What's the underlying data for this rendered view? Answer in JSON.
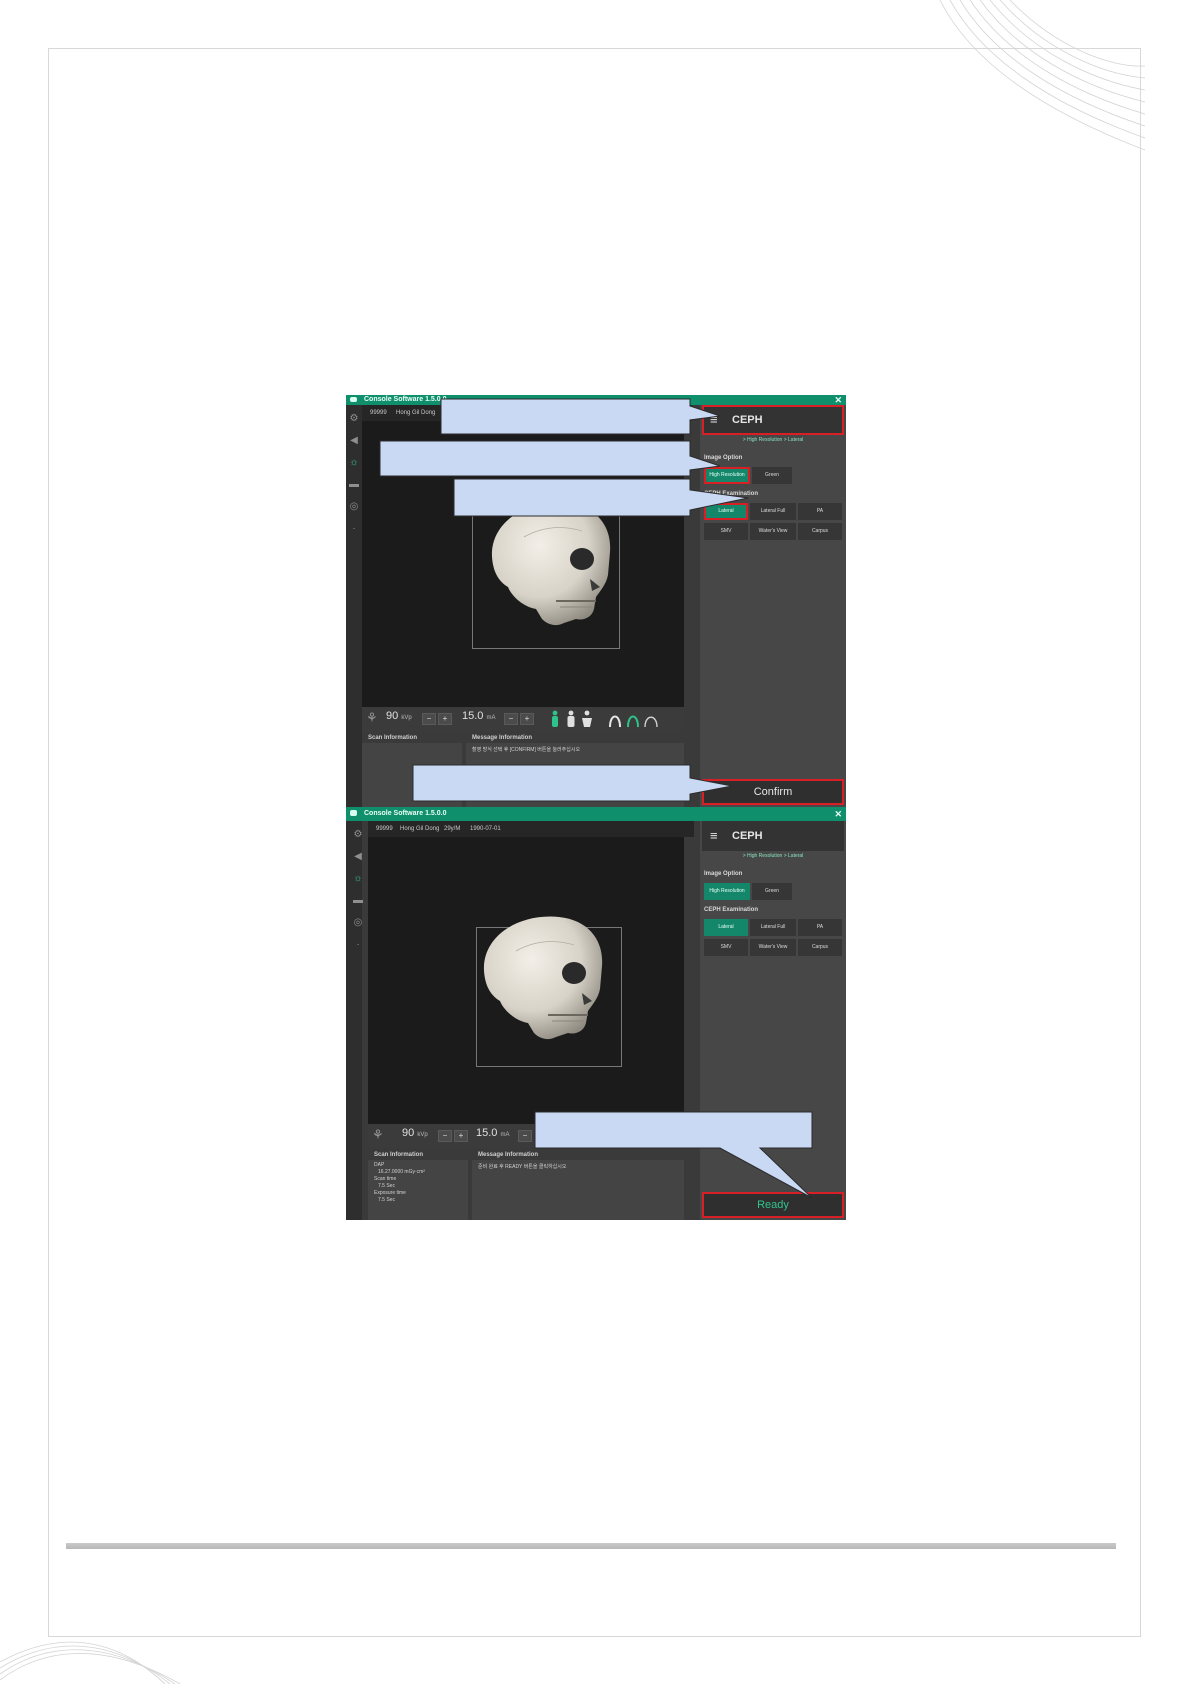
{
  "screens": [
    {
      "window_title": "Console Software 1.5.0.0",
      "patient": {
        "id": "99999",
        "name": "Hong Gil Dong",
        "extra": "",
        "dob": ""
      },
      "kvp": "90",
      "kvp_unit": "kVp",
      "ma": "15.0",
      "ma_unit": "mA",
      "scan_info_title": "Scan Information",
      "scan_info_lines": [],
      "message_title": "Message Information",
      "message_text": "촬영 방식 선택 후 [CONFIRM] 버튼을 눌러주십시오",
      "mode": "CEPH",
      "path": "> High Resolution > Lateral",
      "image_option_label": "Image Option",
      "image_options": [
        "High Resolution",
        "Green"
      ],
      "exam_label": "CEPH Examination",
      "exams": [
        "Lateral",
        "Lateral Full",
        "PA",
        "SMV",
        "Water's View",
        "Carpus"
      ],
      "action_label": "Confirm"
    },
    {
      "window_title": "Console Software 1.5.0.0",
      "patient": {
        "id": "99999",
        "name": "Hong Gil Dong",
        "extra": "29y/M",
        "dob": "1990-07-01"
      },
      "kvp": "90",
      "kvp_unit": "kVp",
      "ma": "15.0",
      "ma_unit": "mA",
      "scan_info_title": "Scan Information",
      "scan_info_lines": [
        "DAP",
        "16.27.0000 mGy·cm²",
        "Scan time",
        "7.5 Sec",
        "Exposure time",
        "7.5 Sec"
      ],
      "message_title": "Message Information",
      "message_text": "준비 완료 후 READY 버튼을 클릭하십시오",
      "mode": "CEPH",
      "path": "> High Resolution > Lateral",
      "image_option_label": "Image Option",
      "image_options": [
        "High Resolution",
        "Green"
      ],
      "exam_label": "CEPH Examination",
      "exams": [
        "Lateral",
        "Lateral Full",
        "PA",
        "SMV",
        "Water's View",
        "Carpus"
      ],
      "action_label": "Ready"
    }
  ],
  "colors": {
    "accent": "#14876a",
    "highlight": "#d81f26",
    "callout": "#c9d9f4"
  }
}
